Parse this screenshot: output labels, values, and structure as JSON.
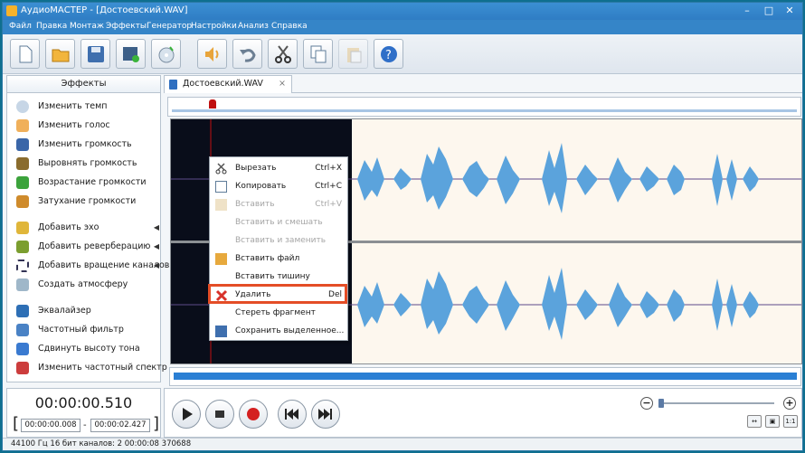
{
  "app": {
    "title": "АудиоМАСТЕР - [Достоевский.WAV]"
  },
  "menu": [
    "Файл",
    "Правка",
    "Монтаж",
    "Эффекты",
    "Генератор",
    "Настройки",
    "Анализ",
    "Справка"
  ],
  "toolbar": {
    "icons": [
      "new-file-icon",
      "open-folder-icon",
      "save-icon",
      "add-video-icon",
      "add-cd-icon",
      "playback-speaker-icon",
      "undo-icon",
      "cut-icon",
      "copy-icon",
      "paste-icon",
      "help-icon"
    ]
  },
  "effects": {
    "header": "Эффекты",
    "items": [
      "Изменить темп",
      "Изменить голос",
      "Изменить громкость",
      "Выровнять громкость",
      "Возрастание громкости",
      "Затухание громкости",
      "Добавить эхо",
      "Добавить реверберацию",
      "Добавить вращение каналов",
      "Создать атмосферу",
      "Эквалайзер",
      "Частотный фильтр",
      "Сдвинуть высоту тона",
      "Изменить частотный спектр"
    ]
  },
  "tab": {
    "label": "Достоевский.WAV",
    "close": "×"
  },
  "context_menu": [
    {
      "label": "Вырезать",
      "shortcut": "Ctrl+X",
      "enabled": true
    },
    {
      "label": "Копировать",
      "shortcut": "Ctrl+C",
      "enabled": true
    },
    {
      "label": "Вставить",
      "shortcut": "Ctrl+V",
      "enabled": false
    },
    {
      "label": "Вставить и смешать",
      "shortcut": "",
      "enabled": false
    },
    {
      "label": "Вставить и заменить",
      "shortcut": "",
      "enabled": false
    },
    {
      "label": "Вставить файл",
      "shortcut": "",
      "enabled": true
    },
    {
      "label": "Вставить тишину",
      "shortcut": "",
      "enabled": true
    },
    {
      "label": "Удалить",
      "shortcut": "Del",
      "enabled": true
    },
    {
      "label": "Стереть фрагмент",
      "shortcut": "",
      "enabled": true
    },
    {
      "label": "Сохранить выделенное...",
      "shortcut": "",
      "enabled": true
    }
  ],
  "time": {
    "current": "00:00:00.510",
    "start": "00:00:00.008",
    "end": "00:00:02.427",
    "sep": "-",
    "open": "[",
    "close": "]"
  },
  "status": "44100 Гц  16 бит  каналов: 2   00:00:08 370688",
  "colors": {
    "accent": "#2f7dc4",
    "waveform": "#5ba3dc",
    "highlight": "#e44d26"
  },
  "zoom": {
    "minus": "−",
    "plus": "+",
    "fit": "1:1"
  }
}
